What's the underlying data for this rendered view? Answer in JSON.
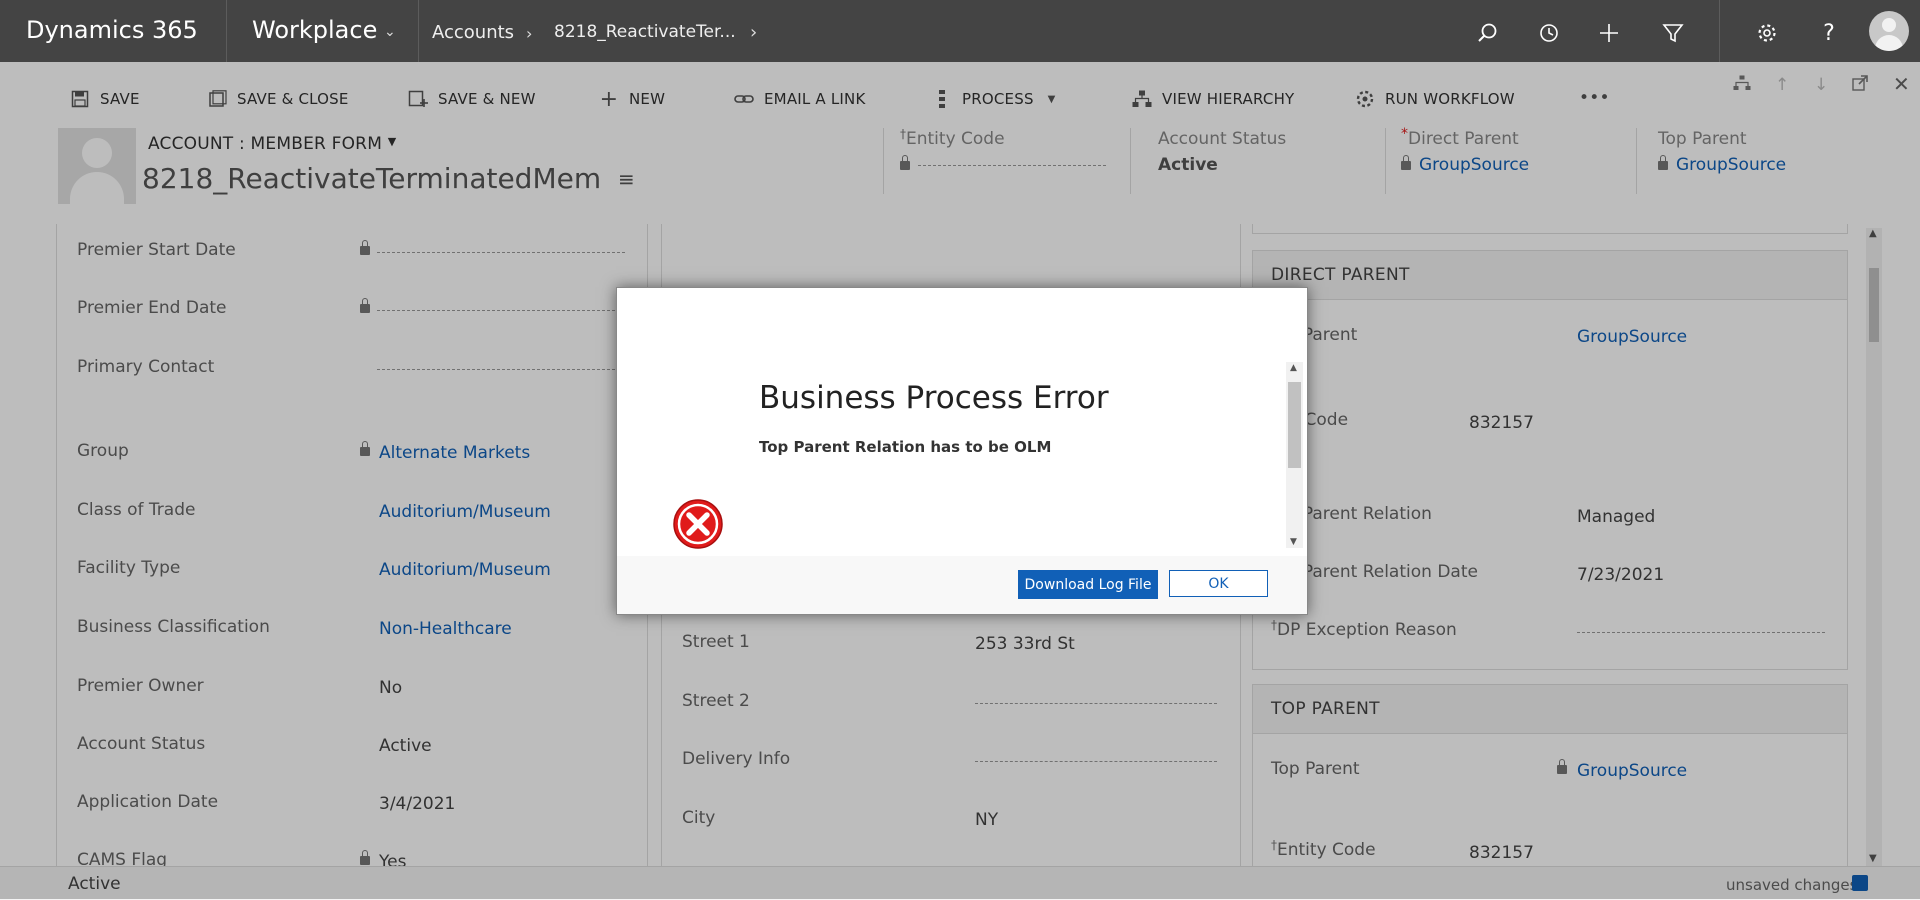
{
  "topbar": {
    "brand": "Dynamics 365",
    "app": "Workplace",
    "breadcrumb": [
      "Accounts",
      "8218_ReactivateTer..."
    ]
  },
  "commands": {
    "save": "SAVE",
    "save_close": "SAVE & CLOSE",
    "save_new": "SAVE & NEW",
    "new": "NEW",
    "email_link": "EMAIL A LINK",
    "process": "PROCESS",
    "view_hierarchy": "VIEW HIERARCHY",
    "run_workflow": "RUN WORKFLOW",
    "more": "•••"
  },
  "header": {
    "form_selector": "ACCOUNT : MEMBER FORM",
    "record_name": "8218_ReactivateTerminatedMem",
    "entity_code_label": "Entity Code",
    "account_status_label": "Account Status",
    "account_status_value": "Active",
    "direct_parent_label": "Direct Parent",
    "direct_parent_value": "GroupSource",
    "top_parent_label": "Top Parent",
    "top_parent_value": "GroupSource"
  },
  "col1": {
    "premier_start_date": "Premier Start Date",
    "premier_end_date": "Premier End Date",
    "primary_contact": "Primary Contact",
    "group_label": "Group",
    "group_value": "Alternate Markets",
    "class_of_trade_label": "Class of Trade",
    "class_of_trade_value": "Auditorium/Museum",
    "facility_type_label": "Facility Type",
    "facility_type_value": "Auditorium/Museum",
    "business_class_label": "Business Classification",
    "business_class_value": "Non-Healthcare",
    "premier_owner_label": "Premier Owner",
    "premier_owner_value": "No",
    "account_status_label": "Account Status",
    "account_status_value": "Active",
    "application_date_label": "Application Date",
    "application_date_value": "3/4/2021",
    "cams_flag_label": "CAMS Flag",
    "cams_flag_value": "Yes"
  },
  "col2": {
    "street1_label": "Street 1",
    "street1_value": "253 33rd St",
    "street2_label": "Street 2",
    "delivery_label": "Delivery Info",
    "city_label": "City",
    "city_value": "NY"
  },
  "direct_parent_section": {
    "title": "DIRECT PARENT",
    "direct_parent_label": "ect Parent",
    "direct_parent_value": "GroupSource",
    "entity_code_label": "tity Code",
    "entity_code_value": "832157",
    "relation_label": "ect Parent Relation",
    "relation_value": "Managed",
    "relation_date_label": "ect Parent Relation Date",
    "relation_date_value": "7/23/2021",
    "exception_label": "DP Exception Reason"
  },
  "top_parent_section": {
    "title": "TOP PARENT",
    "top_parent_label": "Top Parent",
    "top_parent_value": "GroupSource",
    "entity_code_label": "Entity Code",
    "entity_code_value": "832157"
  },
  "footer": {
    "status": "Active",
    "unsaved": "unsaved changes"
  },
  "dialog": {
    "title": "Business Process Error",
    "message": "Top Parent Relation has to be OLM",
    "download_button": "Download Log File",
    "ok_button": "OK"
  },
  "colors": {
    "accent": "#1160b7",
    "topbar": "#444444",
    "error": "#e01b1b"
  }
}
